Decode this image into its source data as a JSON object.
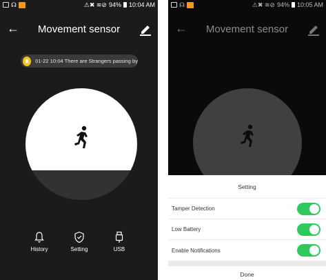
{
  "left_screen": {
    "status_bar": {
      "time": "10:04 AM",
      "battery": "94%"
    },
    "title": "Movement sensor",
    "notification": "01-22 10:04 There are Strangers passing by",
    "nav": [
      {
        "label": "History",
        "icon": "bell-icon"
      },
      {
        "label": "Setting",
        "icon": "shield-icon"
      },
      {
        "label": "USB",
        "icon": "usb-icon"
      }
    ]
  },
  "right_screen": {
    "status_bar": {
      "time": "10:05 AM",
      "battery": "94%"
    },
    "title": "Movement sensor",
    "sheet": {
      "title": "Setting",
      "rows": [
        {
          "label": "Tamper Detection",
          "enabled": true
        },
        {
          "label": "Low Battery",
          "enabled": true
        },
        {
          "label": "Enable Notifications",
          "enabled": true
        }
      ],
      "done_label": "Done"
    }
  },
  "colors": {
    "toggle_on": "#2ec95c",
    "notification_badge": "#f8c21c"
  }
}
